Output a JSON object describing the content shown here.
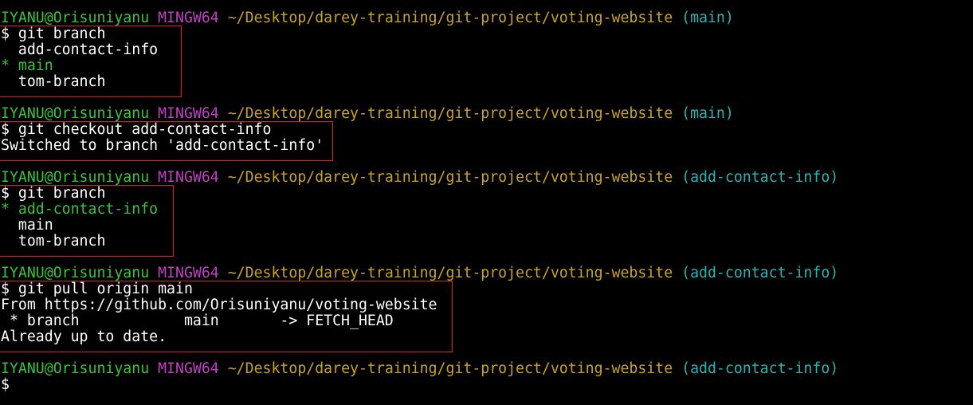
{
  "colors": {
    "background": "#000000",
    "user": "#39c43a",
    "host": "#c33ec3",
    "path": "#c9a426",
    "branch": "#2ab4b4",
    "current_branch": "#39c43a",
    "highlight_box": "#e02020",
    "text": "#ffffff"
  },
  "prompt": {
    "user": "IYANU@Orisuniyanu",
    "host": "MINGW64",
    "path": "~/Desktop/darey-training/git-project/voting-website"
  },
  "blocks": [
    {
      "branch": "(main)",
      "command": "$ git branch",
      "output": [
        "  add-contact-info",
        "* main",
        "  tom-branch"
      ]
    },
    {
      "branch": "(main)",
      "command": "$ git checkout add-contact-info",
      "output": [
        "Switched to branch 'add-contact-info'"
      ]
    },
    {
      "branch": "(add-contact-info)",
      "command": "$ git branch",
      "output": [
        "* add-contact-info",
        "  main",
        "  tom-branch"
      ]
    },
    {
      "branch": "(add-contact-info)",
      "command": "$ git pull origin main",
      "output": [
        "From https://github.com/Orisuniyanu/voting-website",
        " * branch            main       -> FETCH_HEAD",
        "Already up to date."
      ]
    },
    {
      "branch": "(add-contact-info)",
      "command": "$",
      "output": []
    }
  ]
}
